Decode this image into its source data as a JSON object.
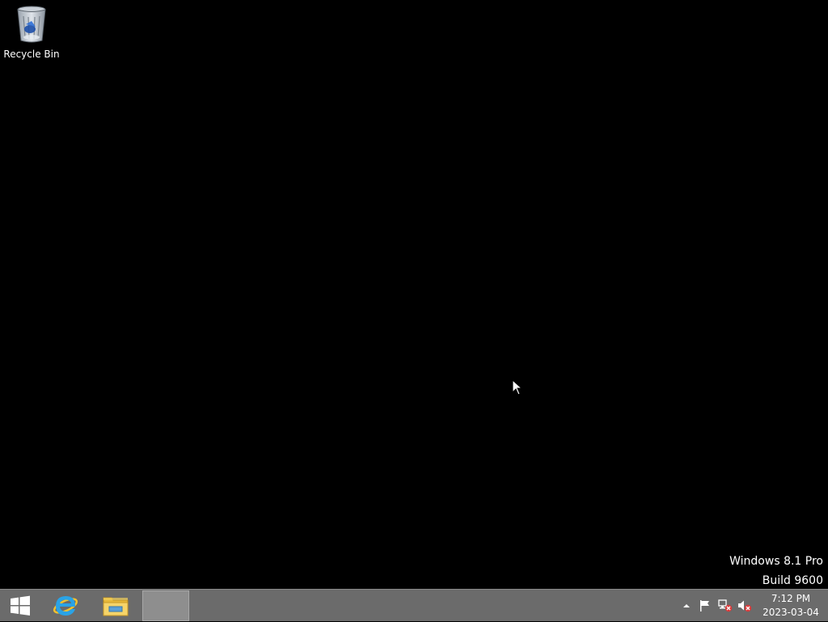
{
  "desktop": {
    "icons": [
      {
        "label": "Recycle Bin",
        "icon": "recycle-bin-icon"
      }
    ],
    "watermark": {
      "line1": "Windows 8.1 Pro",
      "line2": "Build 9600"
    },
    "background_color": "#000000"
  },
  "taskbar": {
    "background_color": "#6b6b6b",
    "start_icon": "windows-logo-icon",
    "pinned": [
      {
        "icon": "internet-explorer-icon"
      },
      {
        "icon": "file-explorer-icon"
      }
    ],
    "tray": {
      "chevron_icon": "show-hidden-icons-chevron",
      "flag_icon": "action-center-flag-icon",
      "network_icon": "network-disconnected-icon",
      "volume_icon": "volume-muted-icon",
      "time": "7:12 PM",
      "date": "2023-03-04"
    }
  }
}
